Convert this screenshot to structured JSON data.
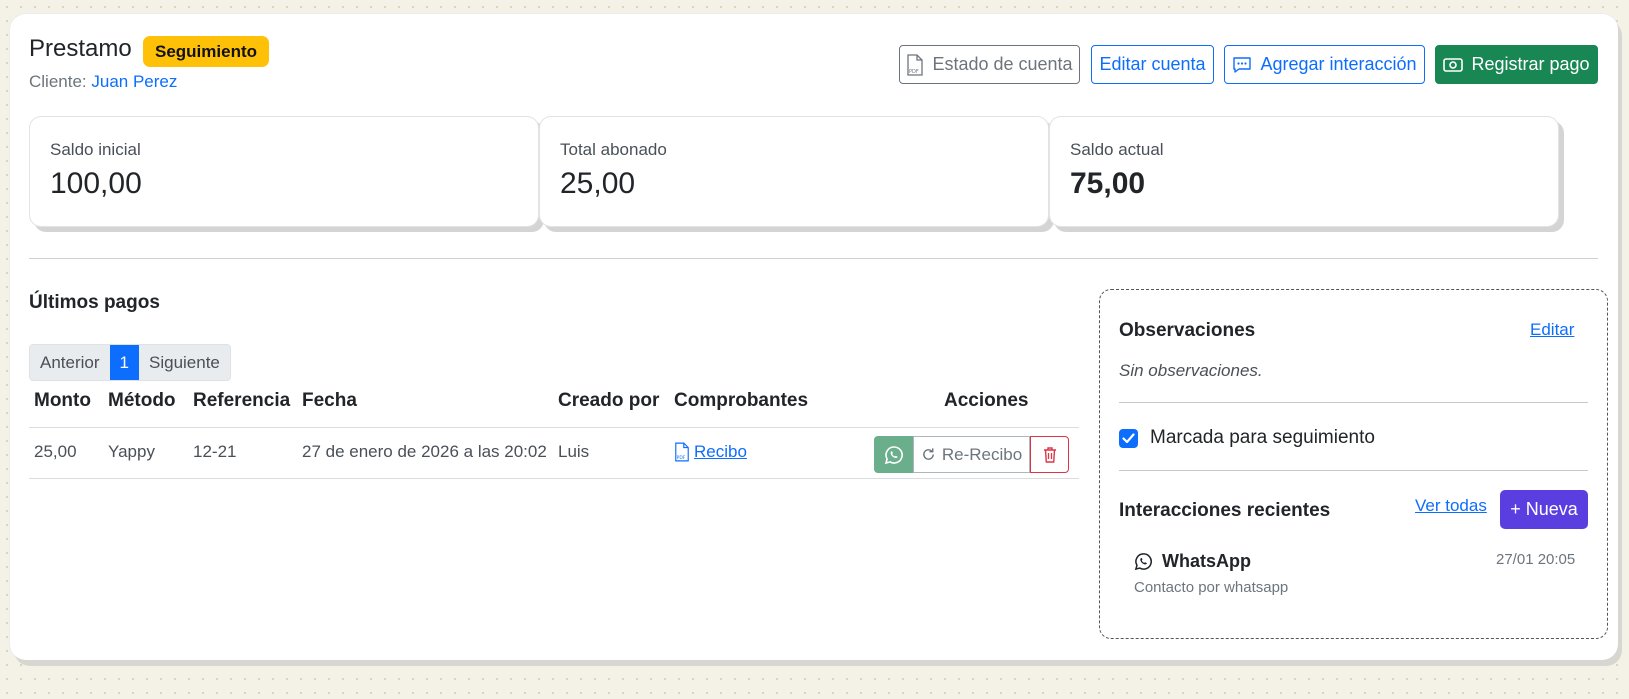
{
  "header": {
    "title": "Prestamo",
    "status_badge": "Seguimiento",
    "client_label": "Cliente:",
    "client_name": "Juan Perez"
  },
  "toolbar": {
    "statement_label": "Estado de cuenta",
    "edit_account_label": "Editar cuenta",
    "add_interaction_label": "Agregar interacción",
    "register_payment_label": "Registrar pago"
  },
  "stats": [
    {
      "label": "Saldo inicial",
      "value": "100,00"
    },
    {
      "label": "Total abonado",
      "value": "25,00"
    },
    {
      "label": "Saldo actual",
      "value": "75,00"
    }
  ],
  "payments": {
    "title": "Últimos pagos",
    "pager": {
      "prev": "Anterior",
      "current": "1",
      "next": "Siguiente"
    },
    "columns": [
      "Monto",
      "Método",
      "Referencia",
      "Fecha",
      "Creado por",
      "Comprobantes",
      "Acciones"
    ],
    "rows": [
      {
        "monto": "25,00",
        "metodo": "Yappy",
        "referencia": "12-21",
        "fecha": "27 de enero de 2026 a las 20:02",
        "creado_por": "Luis",
        "comprobante": "Recibo",
        "rereceipt_label": "Re-Recibo"
      }
    ]
  },
  "observations": {
    "title": "Observaciones",
    "edit_label": "Editar",
    "empty_text": "Sin observaciones.",
    "followup_label": "Marcada para seguimiento",
    "followup_checked": true
  },
  "interactions": {
    "title": "Interacciones recientes",
    "view_all_label": "Ver todas",
    "new_label": "+ Nueva",
    "items": [
      {
        "channel": "WhatsApp",
        "date": "27/01 20:05",
        "description": "Contacto por whatsapp"
      }
    ]
  },
  "colors": {
    "primary": "#0d6efd",
    "success": "#198754",
    "warning": "#ffc107",
    "danger": "#dc3545",
    "accent_purple": "#5a3ee0"
  }
}
